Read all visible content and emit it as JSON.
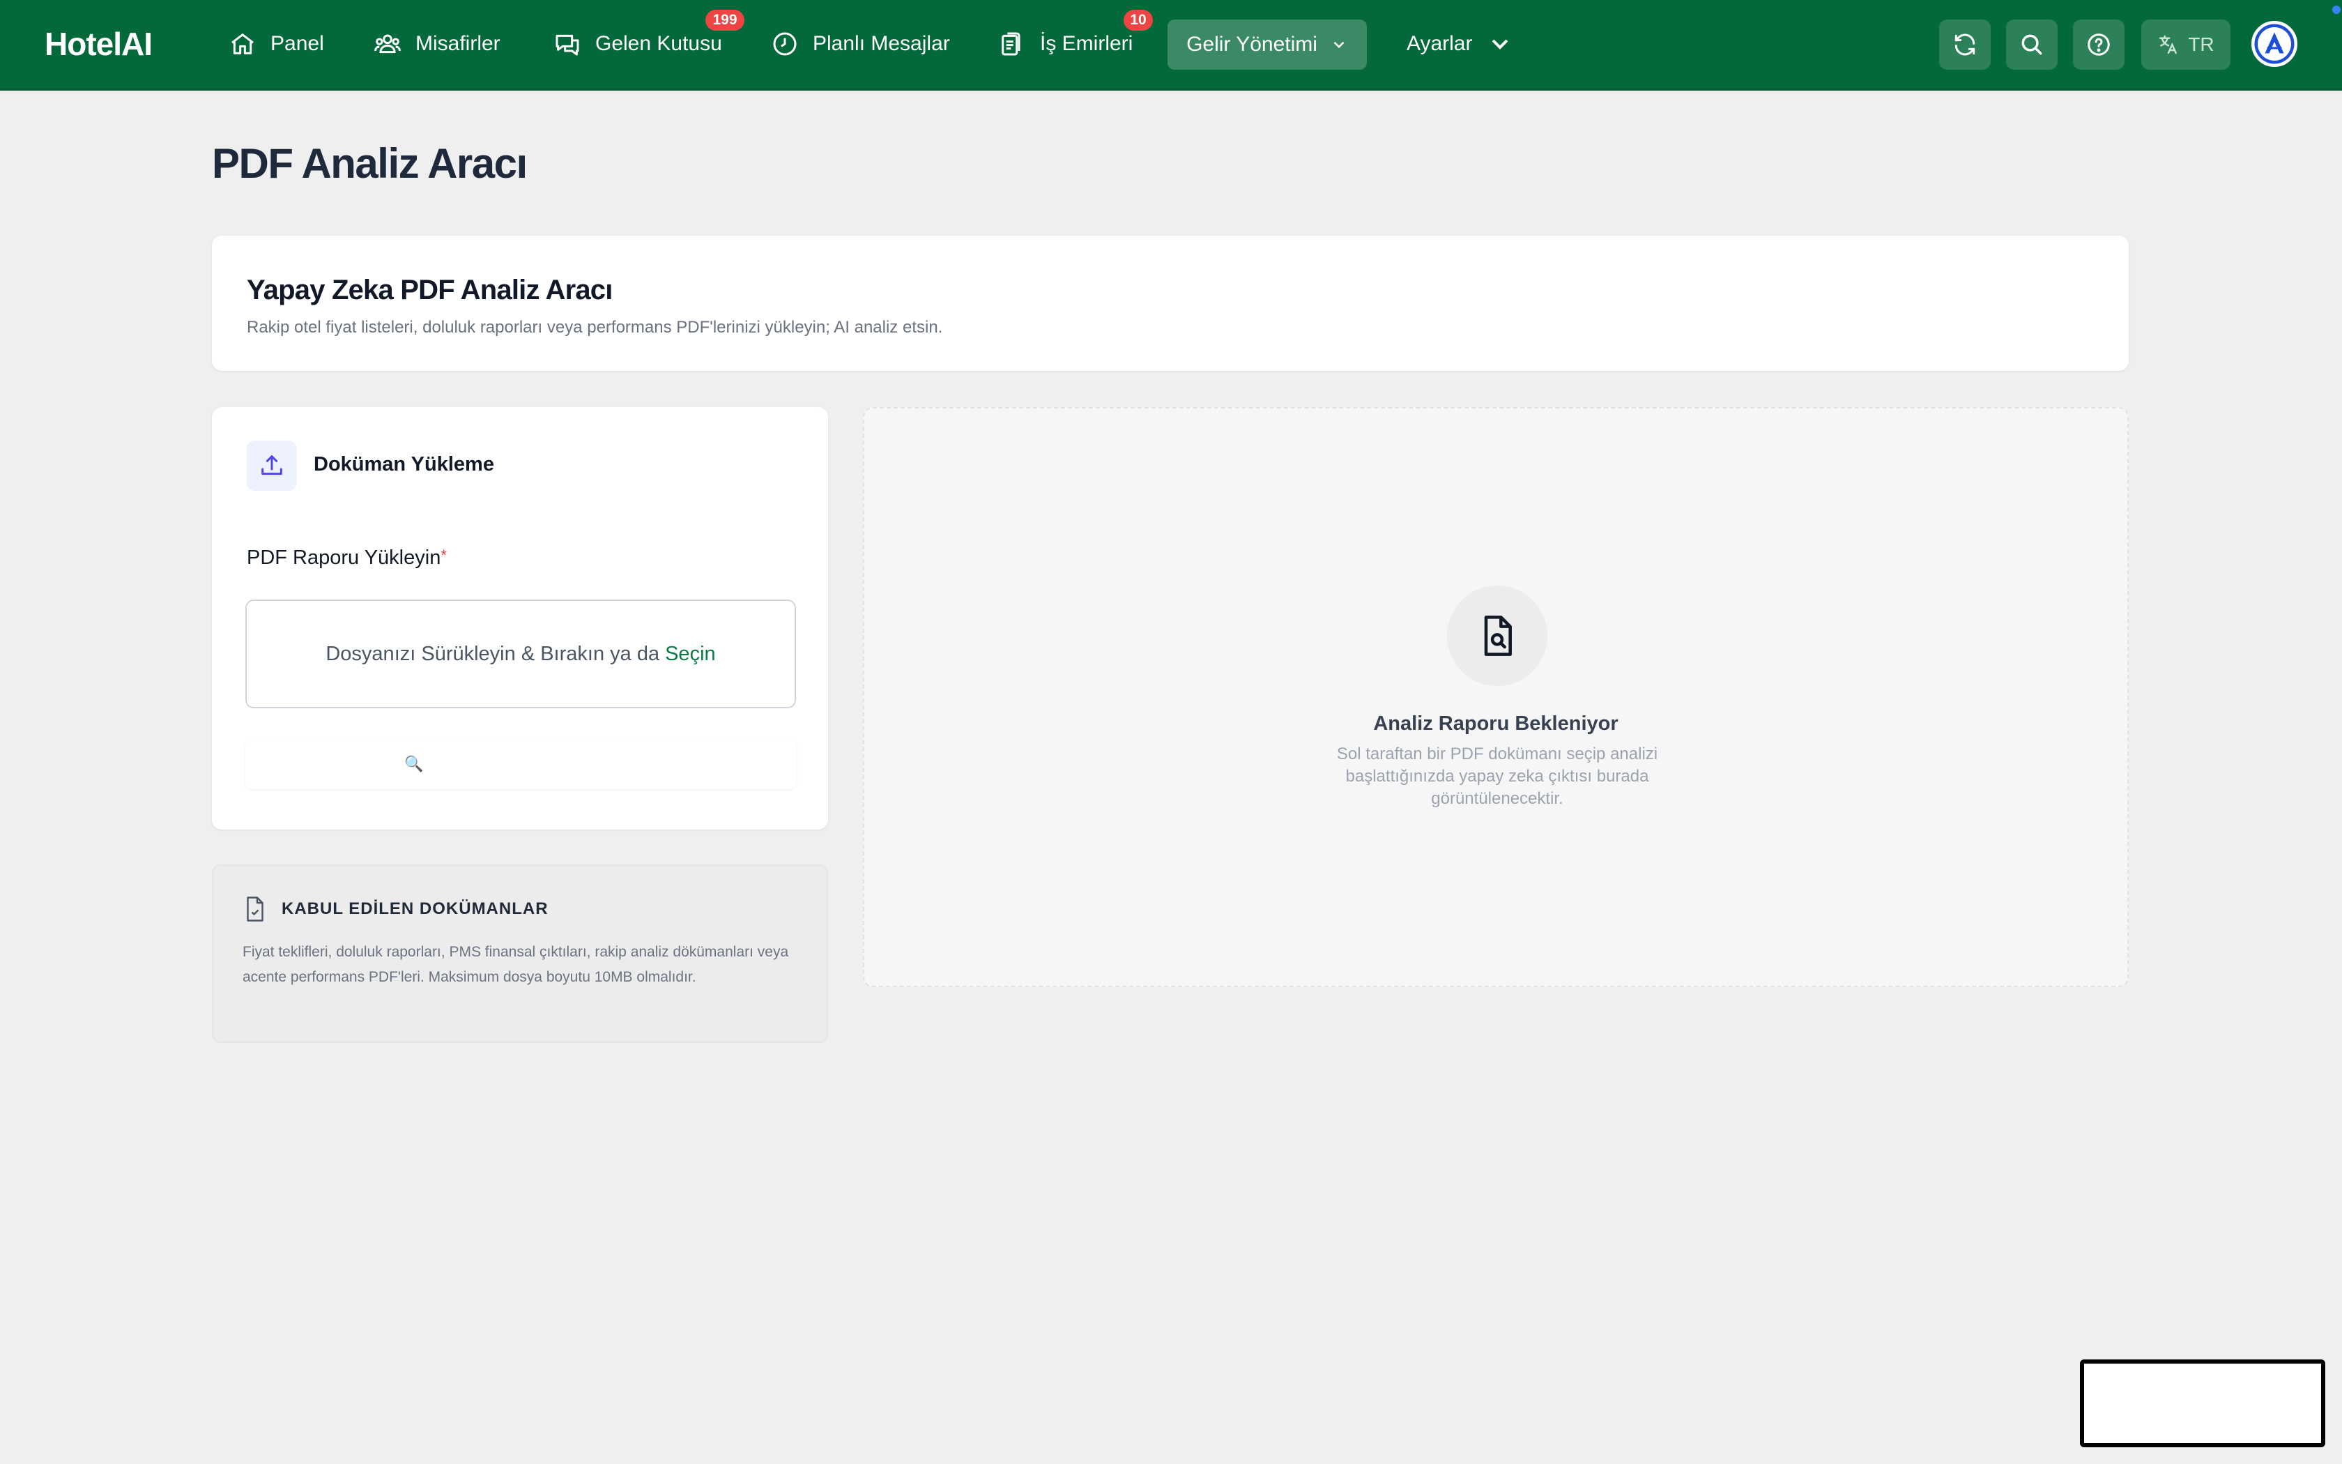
{
  "app": {
    "brand": "HotelAI"
  },
  "nav": {
    "panel": "Panel",
    "guests": "Misafirler",
    "inbox": "Gelen Kutusu",
    "inbox_badge": "199",
    "scheduled": "Planlı Mesajlar",
    "work_orders": "İş Emirleri",
    "work_orders_badge": "10",
    "revenue": "Gelir Yönetimi",
    "settings": "Ayarlar",
    "language": "TR"
  },
  "page": {
    "title": "PDF Analiz Aracı"
  },
  "hero": {
    "title": "Yapay Zeka PDF Analiz Aracı",
    "subtitle": "Rakip otel fiyat listeleri, doluluk raporları veya performans PDF'lerinizi yükleyin; AI analiz etsin."
  },
  "upload": {
    "heading": "Doküman Yükleme",
    "field_label": "PDF Raporu Yükleyin",
    "required_mark": "*",
    "dropzone_text": "Dosyanızı Sürükleyin & Bırakın ya da",
    "dropzone_link": "Seçin",
    "analyze_icon": "🔍"
  },
  "accepted": {
    "title": "KABUL EDİLEN DOKÜMANLAR",
    "text": "Fiyat teklifleri, doluluk raporları, PMS finansal çıktıları, rakip analiz dökümanları veya acente performans PDF'leri. Maksimum dosya boyutu 10MB olmalıdır."
  },
  "result": {
    "title": "Analiz Raporu Bekleniyor",
    "text": "Sol taraftan bir PDF dokümanı seçip analizi başlattığınızda yapay zeka çıktısı burada görüntülenecektir."
  },
  "colors": {
    "navbar": "#04693a",
    "accent": "#0b7a47",
    "badge": "#ef4444",
    "background": "#efefef"
  }
}
